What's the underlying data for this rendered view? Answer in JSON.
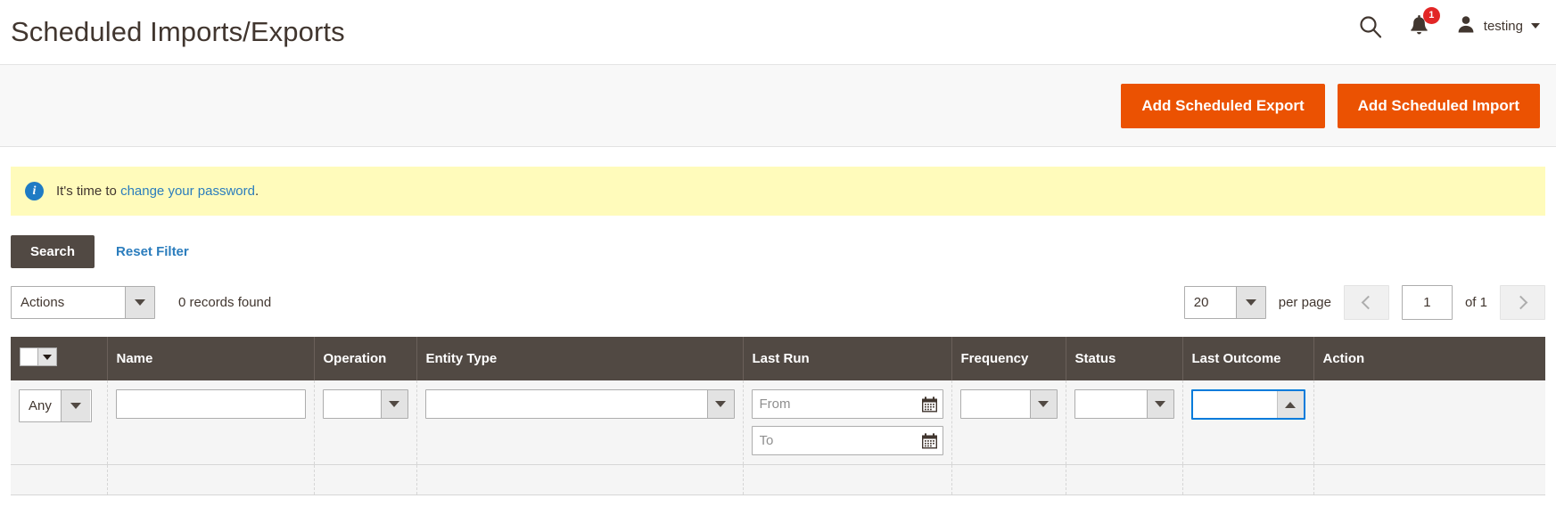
{
  "header": {
    "title": "Scheduled Imports/Exports",
    "search_icon": "search-icon",
    "notifications_icon": "bell-icon",
    "notifications_count": "1",
    "avatar_icon": "user-icon",
    "user_name": "testing"
  },
  "toolbar": {
    "add_export_label": "Add Scheduled Export",
    "add_import_label": "Add Scheduled Import",
    "accent_color": "#eb5202"
  },
  "message": {
    "icon": "info-icon",
    "prefix": "It's time to ",
    "link_text": "change your password",
    "suffix": ".",
    "background": "#fffbbb",
    "link_color": "#2b7dbd"
  },
  "filter_actions": {
    "search_label": "Search",
    "reset_label": "Reset Filter"
  },
  "grid_controls": {
    "actions_value": "Actions",
    "records_found": "0 records found",
    "per_page_value": "20",
    "per_page_label": "per page",
    "page_value": "1",
    "of_pages": "of 1",
    "prev_icon": "chevron-left-icon",
    "next_icon": "chevron-right-icon"
  },
  "grid": {
    "columns": [
      {
        "label": "",
        "key": "select"
      },
      {
        "label": "Name",
        "key": "name"
      },
      {
        "label": "Operation",
        "key": "operation"
      },
      {
        "label": "Entity Type",
        "key": "entity_type"
      },
      {
        "label": "Last Run",
        "key": "last_run"
      },
      {
        "label": "Frequency",
        "key": "frequency"
      },
      {
        "label": "Status",
        "key": "status"
      },
      {
        "label": "Last Outcome",
        "key": "last_outcome"
      },
      {
        "label": "Action",
        "key": "action"
      }
    ],
    "filters": {
      "select_all_value": "Any",
      "name_value": "",
      "operation_value": "",
      "entity_type_value": "",
      "last_run_from_placeholder": "From",
      "last_run_to_placeholder": "To",
      "last_run_from_value": "",
      "last_run_to_value": "",
      "frequency_value": "",
      "status_value": "",
      "last_outcome_value": "",
      "focus_color": "#007bdb",
      "calendar_icon": "calendar-icon"
    },
    "rows": []
  }
}
